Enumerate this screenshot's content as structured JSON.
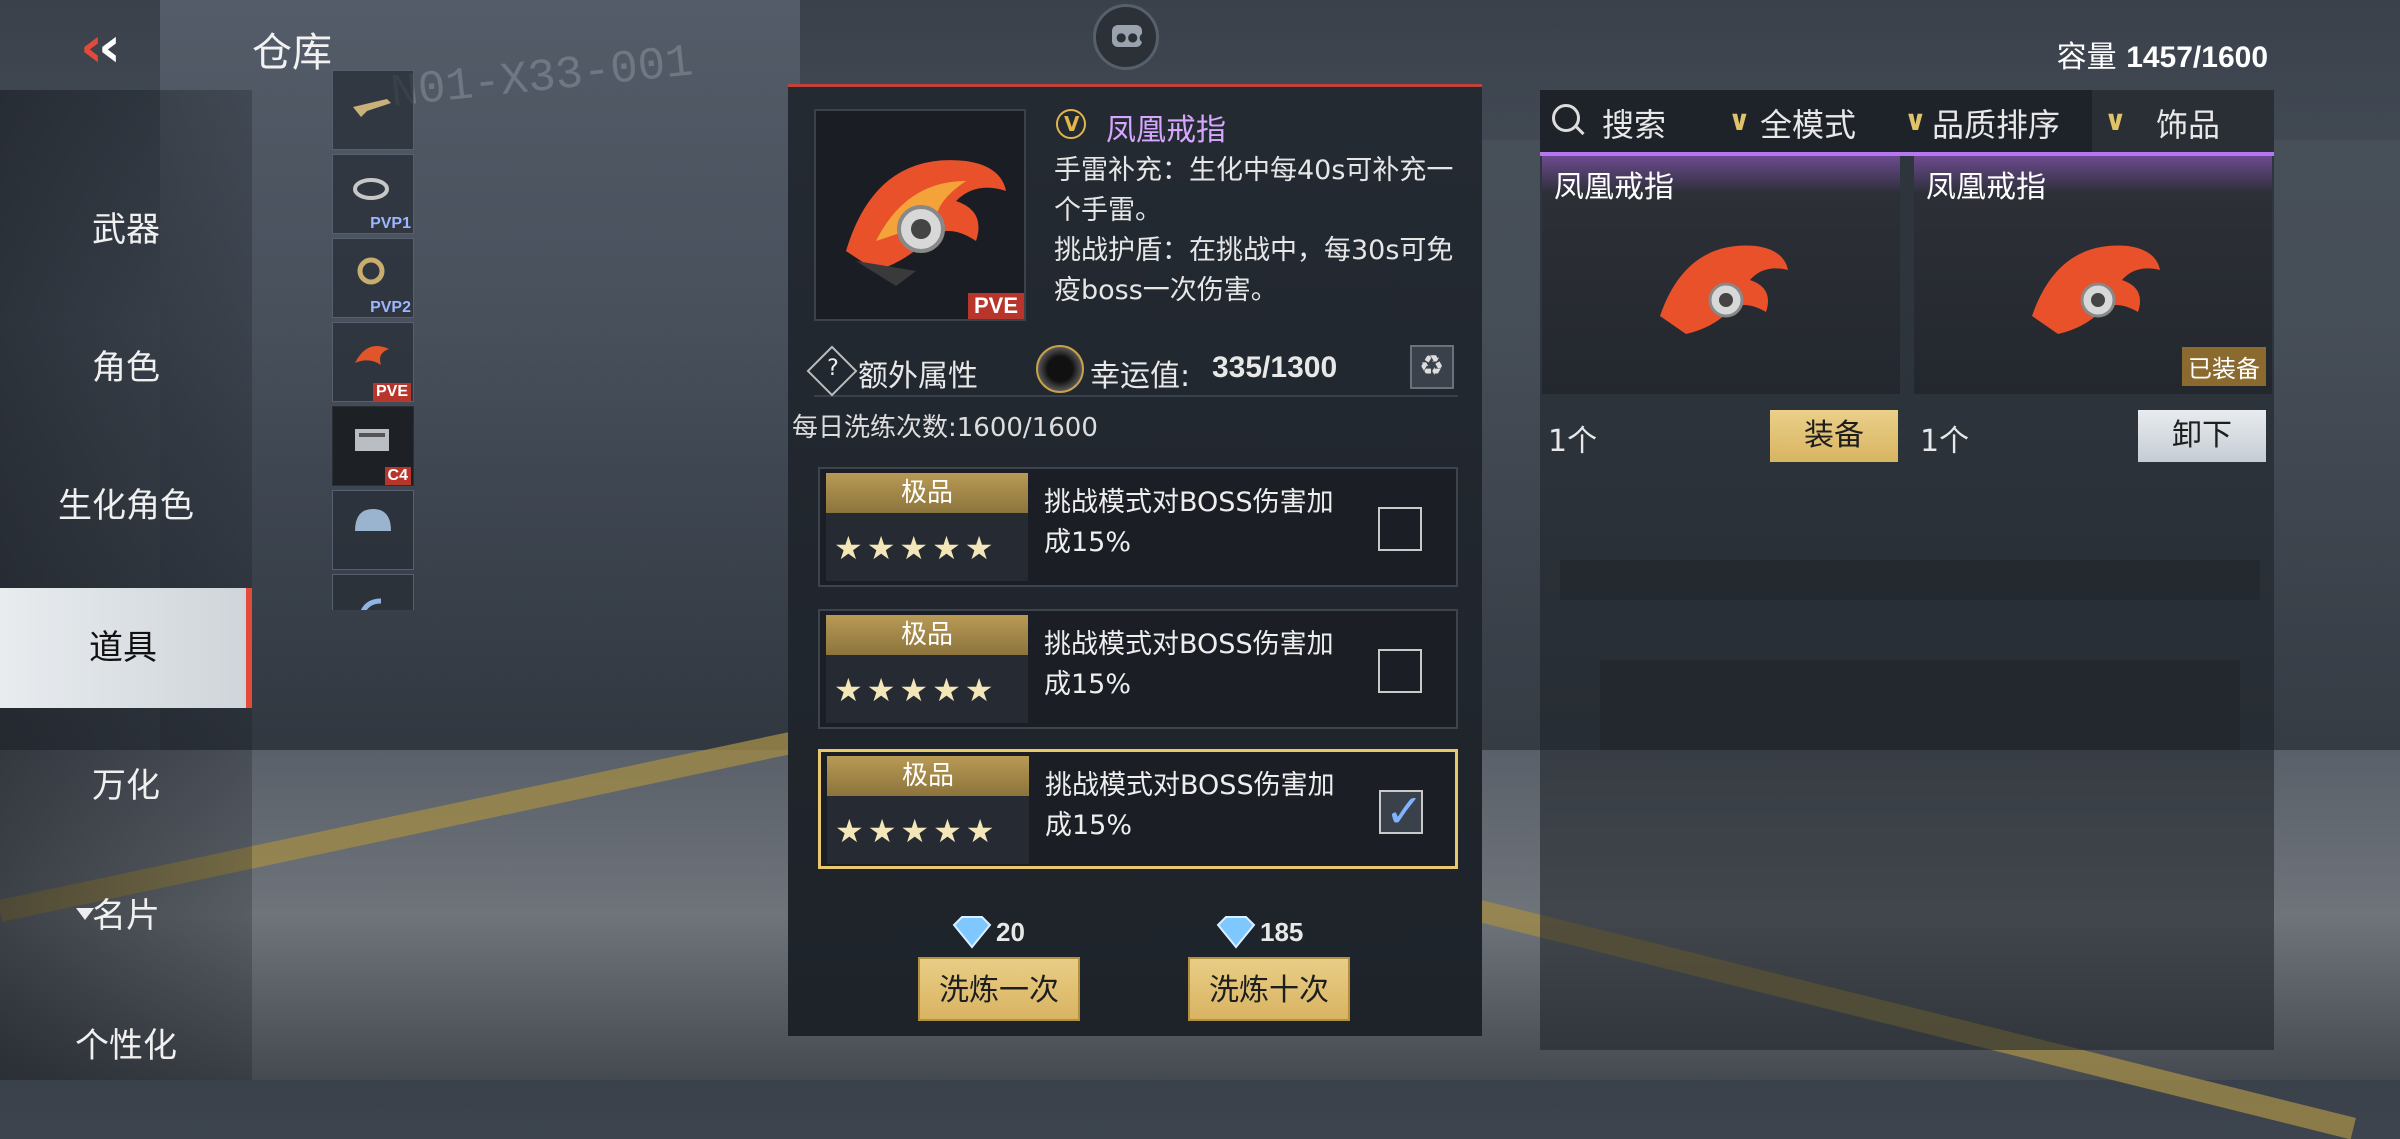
{
  "header": {
    "title": "仓库",
    "capacity_label": "容量",
    "capacity_value": "1457/1600"
  },
  "categories": [
    {
      "label": "武器"
    },
    {
      "label": "角色"
    },
    {
      "label": "生化角色"
    },
    {
      "label": "道具",
      "active": true
    },
    {
      "label": "万化"
    },
    {
      "label": "名片"
    },
    {
      "label": "个性化"
    }
  ],
  "thumbs": [
    {
      "tag": ""
    },
    {
      "tag": "PVP1"
    },
    {
      "tag": "PVP2"
    },
    {
      "tag": "PVE"
    },
    {
      "tag": "C4"
    },
    {
      "tag": ""
    },
    {
      "tag": ""
    }
  ],
  "detail": {
    "name": "凤凰戒指",
    "badge": "PVE",
    "desc": [
      "手雷补充：生化中每40s可补充一个手雷。",
      "挑战护盾：在挑战中，每30s可免疫boss一次伤害。"
    ],
    "extra_label": "额外属性",
    "luck_label": "幸运值:",
    "luck_value": "335/1300",
    "daily_label": "每日洗练次数:1600/1600",
    "attributes": [
      {
        "grade": "极品",
        "stars": "★★★★★",
        "text": "挑战模式对BOSS伤害加成15%",
        "checked": false
      },
      {
        "grade": "极品",
        "stars": "★★★★★",
        "text": "挑战模式对BOSS伤害加成15%",
        "checked": false
      },
      {
        "grade": "极品",
        "stars": "★★★★★",
        "text": "挑战模式对BOSS伤害加成15%",
        "checked": true
      }
    ],
    "wash_once": {
      "cost": "20",
      "label": "洗炼一次"
    },
    "wash_ten": {
      "cost": "185",
      "label": "洗炼十次"
    }
  },
  "inventory": {
    "search_label": "搜索",
    "mode_filter": "全模式",
    "sort_filter": "品质排序",
    "type_filter": "饰品",
    "items": [
      {
        "name": "凤凰戒指",
        "count": "1个",
        "action": "装备",
        "equipped": false
      },
      {
        "name": "凤凰戒指",
        "count": "1个",
        "action": "卸下",
        "equipped": true,
        "equipped_label": "已装备"
      }
    ]
  },
  "colors": {
    "accent_gold": "#d8b462",
    "rarity_purple": "#b676f2",
    "alert_red": "#e34a3a"
  }
}
